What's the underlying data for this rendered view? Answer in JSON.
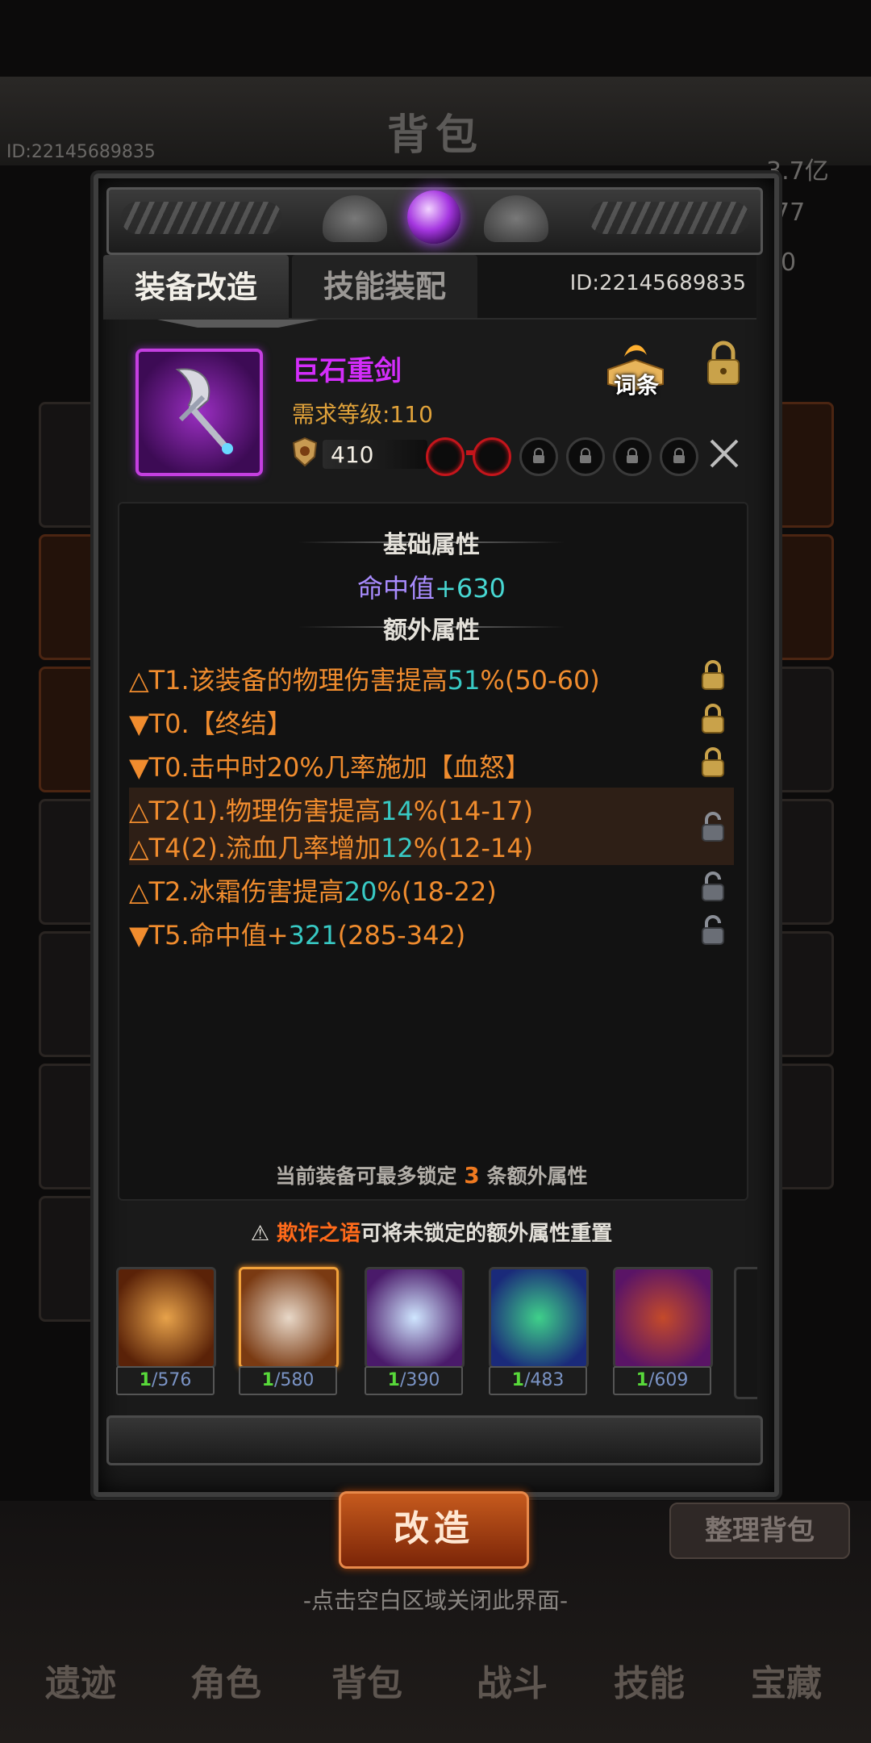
{
  "background": {
    "title": "背包",
    "player_id": "ID:22145689835",
    "gold": "3.7亿",
    "gems": "77",
    "stat": "0",
    "sort_button": "整理背包",
    "close_hint": "-点击空白区域关闭此界面-",
    "nav": [
      "遗迹",
      "角色",
      "背包",
      "战斗",
      "技能",
      "宝藏"
    ]
  },
  "modal": {
    "tabs": [
      {
        "label": "装备改造",
        "active": true
      },
      {
        "label": "技能装配",
        "active": false
      }
    ],
    "id_label": "ID:22145689835",
    "item": {
      "name": "巨石重剑",
      "requirement": "需求等级:110",
      "power": "410",
      "affix_button": "词条"
    },
    "base_header": "基础属性",
    "base_stat": {
      "prefix": "命中值",
      "value": "+630"
    },
    "extra_header": "额外属性",
    "affixes": [
      {
        "pre": "△T1.该装备的物理伤害提高",
        "hl": "51",
        "post": "%(50-60)",
        "locked": true
      },
      {
        "pre": "▼T0.【终结】",
        "hl": "",
        "post": "",
        "locked": true
      },
      {
        "pre": "▼T0.击中时20%几率施加【血怒】",
        "hl": "",
        "post": "",
        "locked": true
      },
      {
        "pre": "△T2(1).物理伤害提高",
        "hl": "14",
        "post": "%(14-17)",
        "locked": false
      },
      {
        "pre": "△T4(2).流血几率增加",
        "hl": "12",
        "post": "%(12-14)",
        "locked": false
      },
      {
        "pre": "△T2.冰霜伤害提高",
        "hl": "20",
        "post": "%(18-22)",
        "locked": false
      },
      {
        "pre": "▼T5.命中值+",
        "hl": "321",
        "post": "(285-342)",
        "locked": false
      }
    ],
    "lock_limit": {
      "pre": "当前装备可最多锁定",
      "num": "3",
      "post": "条额外属性"
    },
    "material_header": {
      "name": "欺诈之语",
      "text": "可将未锁定的额外属性重置"
    },
    "materials": [
      {
        "icon": "orb-eye-icon",
        "current": "1",
        "total": "/576",
        "color": "#b4541c"
      },
      {
        "icon": "mask-icon",
        "current": "1",
        "total": "/580",
        "color": "#c8661e"
      },
      {
        "icon": "ice-crystal-icon",
        "current": "1",
        "total": "/390",
        "color": "#6a2a88"
      },
      {
        "icon": "rainbow-ore-icon",
        "current": "1",
        "total": "/483",
        "color": "#2b3f8f"
      },
      {
        "icon": "ember-stone-icon",
        "current": "1",
        "total": "/609",
        "color": "#7c1f86"
      }
    ],
    "reforge_button": "改造"
  }
}
